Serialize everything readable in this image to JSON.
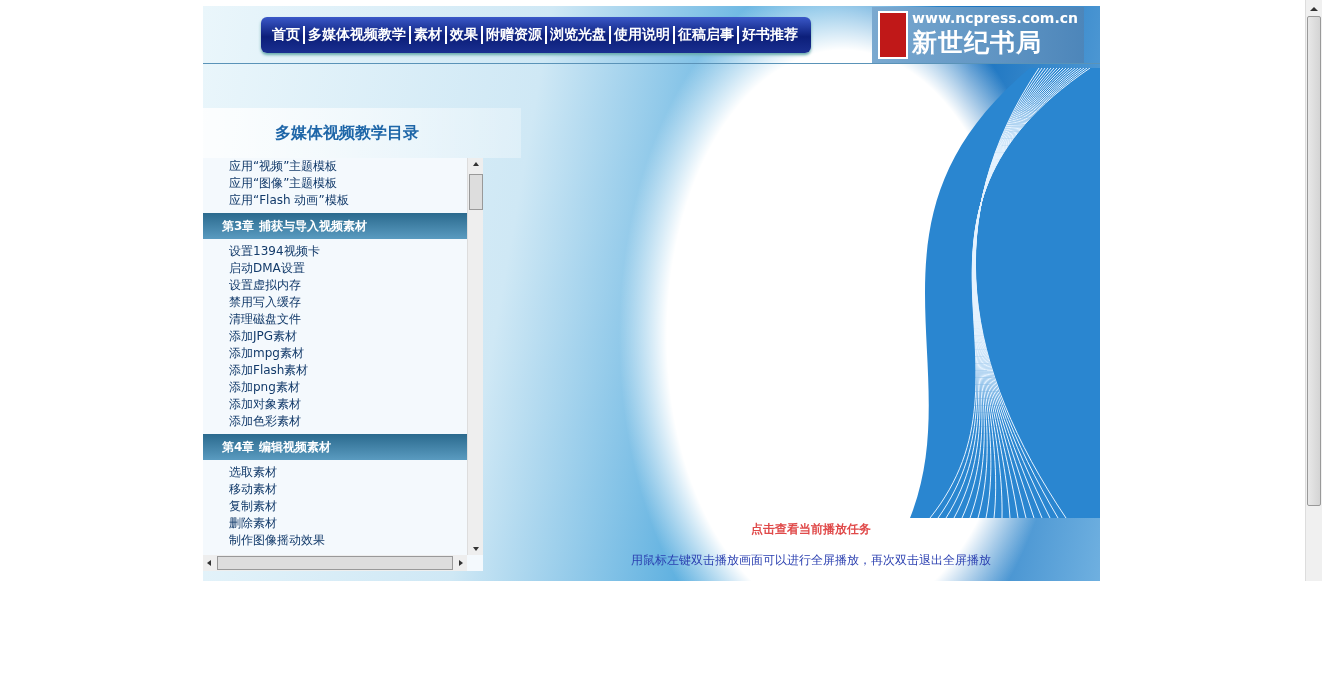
{
  "header": {
    "nav": [
      "首页",
      "多媒体视频教学",
      "素材",
      "效果",
      "附赠资源",
      "浏览光盘",
      "使用说明",
      "征稿启事",
      "好书推荐"
    ],
    "site_url": "www.ncpress.com.cn",
    "site_name": "新世纪书局"
  },
  "toc": {
    "title": "多媒体视频教学目录",
    "entries": [
      {
        "kind": "lesson",
        "label": "应用“视频”主题模板"
      },
      {
        "kind": "lesson",
        "label": "应用“图像”主题模板"
      },
      {
        "kind": "lesson",
        "label": "应用“Flash 动画”模板"
      },
      {
        "kind": "chapter",
        "label": "第3章  捕获与导入视频素材"
      },
      {
        "kind": "lesson",
        "label": "设置1394视频卡"
      },
      {
        "kind": "lesson",
        "label": "启动DMA设置"
      },
      {
        "kind": "lesson",
        "label": "设置虚拟内存"
      },
      {
        "kind": "lesson",
        "label": "禁用写入缓存"
      },
      {
        "kind": "lesson",
        "label": "清理磁盘文件"
      },
      {
        "kind": "lesson",
        "label": "添加JPG素材"
      },
      {
        "kind": "lesson",
        "label": "添加mpg素材"
      },
      {
        "kind": "lesson",
        "label": "添加Flash素材"
      },
      {
        "kind": "lesson",
        "label": "添加png素材"
      },
      {
        "kind": "lesson",
        "label": "添加对象素材"
      },
      {
        "kind": "lesson",
        "label": "添加色彩素材"
      },
      {
        "kind": "chapter",
        "label": "第4章  编辑视频素材"
      },
      {
        "kind": "lesson",
        "label": "选取素材"
      },
      {
        "kind": "lesson",
        "label": "移动素材"
      },
      {
        "kind": "lesson",
        "label": "复制素材"
      },
      {
        "kind": "lesson",
        "label": "删除素材"
      },
      {
        "kind": "lesson",
        "label": "制作图像摇动效果"
      }
    ]
  },
  "player": {
    "task_link": "点击查看当前播放任务",
    "hint": "用鼠标左键双击播放画面可以进行全屏播放，再次双击退出全屏播放"
  }
}
